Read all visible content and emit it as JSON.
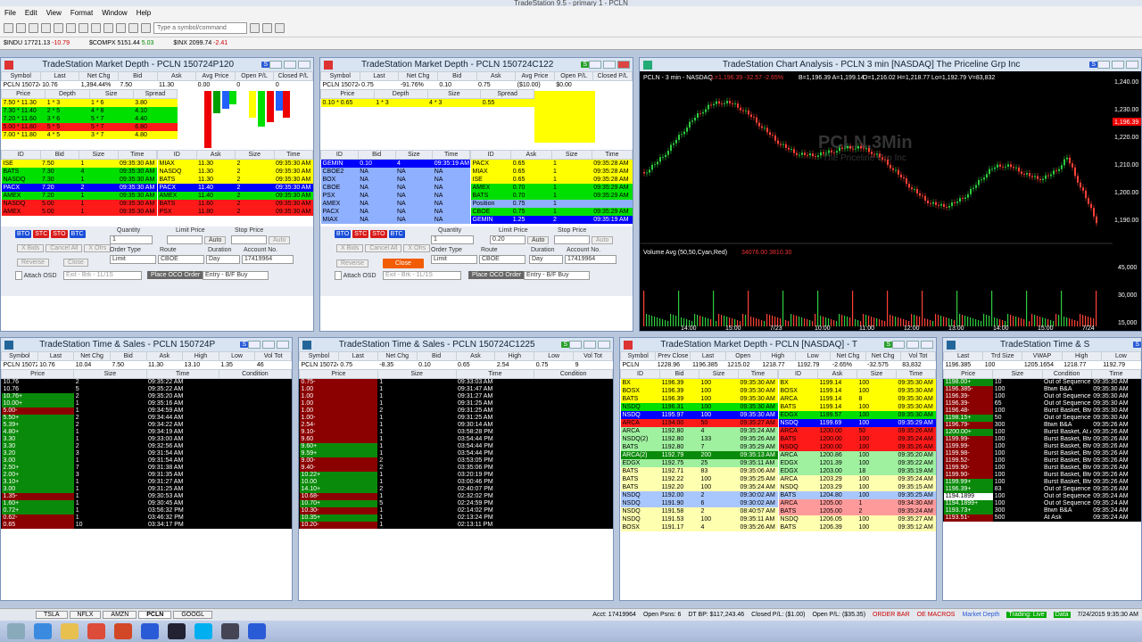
{
  "app": {
    "title": "TradeStation 9.5 - primary 1 - PCLN"
  },
  "menu": [
    "File",
    "Edit",
    "View",
    "Format",
    "Window",
    "Help"
  ],
  "toolbar": {
    "symbol_placeholder": "Type a symbol/command"
  },
  "tickers": [
    {
      "sym": "$INDU",
      "last": "17721.13",
      "chg": "-10.79"
    },
    {
      "sym": "$COMPX",
      "last": "5151.44",
      "chg": "5.03"
    },
    {
      "sym": "$INX",
      "last": "2099.74",
      "chg": "-2.41"
    }
  ],
  "md1": {
    "title": "TradeStation Market Depth - PCLN 150724P120",
    "badge": "S",
    "cols": [
      "Symbol",
      "Last",
      "Net Chg",
      "Bid",
      "Ask",
      "Avg Price",
      "Open P/L",
      "Closed P/L"
    ],
    "row": [
      "PCLN 150724P1205",
      "10.76",
      "1,394.44%",
      "7.50",
      "11.30",
      "0.00",
      "0",
      "0"
    ],
    "ladder_cols": [
      "Price",
      "Depth",
      "Size",
      "Spread"
    ],
    "ladder": [
      [
        "7.50 * 11.30",
        "1 * 3",
        "1 * 6",
        "3.80"
      ],
      [
        "7.30 * 11.40",
        "2 * 5",
        "4 * 8",
        "4.10"
      ],
      [
        "7.20 * 11.60",
        "3 * 6",
        "5 * 7",
        "4.40"
      ],
      [
        "5.00 * 11.80",
        "5 * 5",
        "5 * 7",
        "6.80"
      ],
      [
        "7.00 * 11.80",
        "4 * 5",
        "3 * 7",
        "4.80"
      ]
    ],
    "bid_cols": [
      "ID",
      "Bid",
      "Size",
      "Time"
    ],
    "bids": [
      [
        "ISE",
        "7.50",
        "1",
        "09:35:30 AM"
      ],
      [
        "BATS",
        "7.30",
        "4",
        "09:35:30 AM"
      ],
      [
        "NASDQ",
        "7.30",
        "1",
        "09:35:30 AM"
      ],
      [
        "PACX",
        "7.20",
        "2",
        "09:35:30 AM"
      ],
      [
        "AMEX",
        "7.20",
        "1",
        "09:35:30 AM"
      ],
      [
        "NASDQ",
        "5.00",
        "1",
        "09:35:30 AM"
      ],
      [
        "AMEX",
        "5.00",
        "1",
        "09:35:30 AM"
      ]
    ],
    "ask_cols": [
      "ID",
      "Ask",
      "Size",
      "Time"
    ],
    "asks": [
      [
        "MIAX",
        "11.30",
        "2",
        "09:35:30 AM"
      ],
      [
        "NASDQ",
        "11.30",
        "2",
        "09:35:30 AM"
      ],
      [
        "BATS",
        "11.30",
        "2",
        "09:35:30 AM"
      ],
      [
        "PACX",
        "11.40",
        "2",
        "09:35:30 AM"
      ],
      [
        "AMEX",
        "11.40",
        "2",
        "09:35:30 AM"
      ],
      [
        "BATS",
        "11.60",
        "2",
        "09:35:30 AM"
      ],
      [
        "PSX",
        "11.80",
        "2",
        "09:35:30 AM"
      ]
    ],
    "order": {
      "qty_label": "Quantity",
      "qty": "1",
      "limit_label": "Limit Price",
      "stop_label": "Stop Price",
      "type_label": "Order Type",
      "type": "Limit",
      "route_label": "Route",
      "route": "CBOE",
      "dur_label": "Duration",
      "dur": "Day",
      "acct_label": "Account No.",
      "acct": "17419964",
      "attach": "Attach OSD",
      "exit": "Exit - Brk - 1L/1S",
      "oco": "Place OCO Order",
      "entry": "Entry - B/F Buy",
      "reverse": "Reverse",
      "close": "Close",
      "xbids": "X Bids",
      "cancel_all": "Cancel All",
      "xoffers": "X Ofrs",
      "auto": "Auto"
    }
  },
  "md2": {
    "title": "TradeStation Market Depth - PCLN 150724C122",
    "badge": "S",
    "row": [
      "PCLN 150724C1225",
      "0.75",
      "-91.76%",
      "0.10",
      "0.75",
      "($10.00)",
      "$0.00"
    ],
    "cols": [
      "Symbol",
      "Last",
      "Net Chg",
      "Bid",
      "Ask",
      "Avg Price",
      "Open P/L",
      "Closed P/L"
    ],
    "ladder": [
      [
        "0.10 * 0.65",
        "1 * 3",
        "4 * 3",
        "0.55"
      ]
    ],
    "bids": [
      [
        "GEMIN",
        "0.10",
        "4",
        "09:35:19 AM"
      ],
      [
        "CBOE2",
        "NA",
        "NA",
        "NA"
      ],
      [
        "BOX",
        "NA",
        "NA",
        "NA"
      ],
      [
        "CBOE",
        "NA",
        "NA",
        "NA"
      ],
      [
        "PSX",
        "NA",
        "NA",
        "NA"
      ],
      [
        "AMEX",
        "NA",
        "NA",
        "NA"
      ],
      [
        "PACX",
        "NA",
        "NA",
        "NA"
      ],
      [
        "MIAX",
        "NA",
        "NA",
        "NA"
      ]
    ],
    "asks": [
      [
        "PACX",
        "0.65",
        "1",
        "09:35:28 AM"
      ],
      [
        "MIAX",
        "0.65",
        "1",
        "09:35:28 AM"
      ],
      [
        "ISE",
        "0.65",
        "1",
        "09:35:28 AM"
      ],
      [
        "AMEX",
        "0.70",
        "1",
        "09:35:29 AM"
      ],
      [
        "BATS",
        "0.70",
        "1",
        "09:35:29 AM"
      ],
      [
        "Position",
        "0.75",
        "1",
        ""
      ],
      [
        "CBOE",
        "0.75",
        "1",
        "09:35:29 AM"
      ],
      [
        "GEMIN",
        "1.25",
        "2",
        "09:35:19 AM"
      ]
    ],
    "limit_val": "0.20"
  },
  "chart": {
    "title": "TradeStation Chart Analysis - PCLN 3 min [NASDAQ] The Priceline Grp Inc",
    "badge": "S",
    "legend": "PCLN - 3 min - NASDAQ",
    "lastq": "L=1,196.39 -32.57 -2.65%",
    "bar": "B=1,196.39 A=1,199.14",
    "ohlc": "O=1,216.02 H=1,218.77 Lo=1,192.79 V=83,832",
    "watermark": "PCLN,3Min",
    "watermark_sub": "The Priceline Grp Inc",
    "vol_label": "Volume Avg (50,50,Cyan,Red)",
    "vol_vals": "34076.00  3810.30",
    "price_ticks": [
      "1,240.00",
      "1,230.00",
      "1,220.00",
      "1,210.00",
      "1,200.00",
      "1,190.00"
    ],
    "vol_ticks": [
      "45,000",
      "30,000",
      "15,000"
    ],
    "last_price": "1,196.39",
    "time_ticks": [
      "14:00",
      "15:00",
      "7/23",
      "10:00",
      "11:00",
      "12:00",
      "13:00",
      "14:00",
      "15:00",
      "7/24"
    ]
  },
  "ts1": {
    "title": "TradeStation Time & Sales - PCLN 150724P",
    "badge": "S",
    "cols": [
      "Symbol",
      "Last",
      "Net Chg",
      "Bid",
      "Ask",
      "High",
      "Low",
      "Vol Tot"
    ],
    "row": [
      "PCLN 150724P1205",
      "10.76",
      "10.04",
      "7.50",
      "11.30",
      "13.10",
      "1.35",
      "46"
    ],
    "grid_cols": [
      "Price",
      "Size",
      "Time",
      "Condition"
    ],
    "rows": [
      [
        "10.76",
        "2",
        "09:35:22 AM",
        "b"
      ],
      [
        "10.76",
        "5",
        "09:35:22 AM",
        "b"
      ],
      [
        "10.76+",
        "2",
        "09:35:20 AM",
        "g"
      ],
      [
        "10.00+",
        "1",
        "09:35:16 AM",
        "g"
      ],
      [
        "5.00-",
        "1",
        "09:34:59 AM",
        "r"
      ],
      [
        "5.50+",
        "2",
        "09:34:44 AM",
        "g"
      ],
      [
        "5.39+",
        "2",
        "09:34:22 AM",
        "g"
      ],
      [
        "4.80+",
        "1",
        "09:34:19 AM",
        "g"
      ],
      [
        "3.30",
        "1",
        "09:33:00 AM",
        "g"
      ],
      [
        "3.30",
        "2",
        "09:32:56 AM",
        "g"
      ],
      [
        "3.20",
        "3",
        "09:31:54 AM",
        "g"
      ],
      [
        "3.00",
        "1",
        "09:31:54 AM",
        "g"
      ],
      [
        "2.50+",
        "7",
        "09:31:38 AM",
        "g"
      ],
      [
        "2.00+",
        "3",
        "09:31:35 AM",
        "g"
      ],
      [
        "3.10+",
        "1",
        "09:31:27 AM",
        "g"
      ],
      [
        "3.00",
        "1",
        "09:31:25 AM",
        "g"
      ],
      [
        "1.35-",
        "1",
        "09:30:53 AM",
        "r"
      ],
      [
        "1.60+",
        "1",
        "09:30:45 AM",
        "g"
      ],
      [
        "0.72+",
        "1",
        "03:56:32 PM",
        "g"
      ],
      [
        "0.62-",
        "1",
        "03:46:32 PM",
        "r"
      ],
      [
        "0.65",
        "10",
        "03:34:17 PM",
        "r"
      ]
    ]
  },
  "ts2": {
    "title": "TradeStation Time & Sales - PCLN 150724C1225",
    "badge": "S",
    "row": [
      "PCLN 150724C1225",
      "0.75",
      "-8.35",
      "0.10",
      "0.65",
      "2.54",
      "0.75",
      "9"
    ],
    "rows": [
      [
        "0.75-",
        "1",
        "09:33:03 AM",
        "r"
      ],
      [
        "1.00",
        "1",
        "09:31:47 AM",
        "r"
      ],
      [
        "1.00",
        "1",
        "09:31:27 AM",
        "r"
      ],
      [
        "1.00",
        "1",
        "09:31:25 AM",
        "r"
      ],
      [
        "1.00",
        "2",
        "09:31:25 AM",
        "r"
      ],
      [
        "1.00-",
        "1",
        "09:31:25 AM",
        "r"
      ],
      [
        "2.54-",
        "1",
        "09:30:14 AM",
        "r"
      ],
      [
        "9.10-",
        "1",
        "03:58:28 PM",
        "r"
      ],
      [
        "9.60",
        "1",
        "03:54:44 PM",
        "r"
      ],
      [
        "9.60+",
        "1",
        "03:54:44 PM",
        "g"
      ],
      [
        "9.59+",
        "1",
        "03:54:44 PM",
        "g"
      ],
      [
        "9.00-",
        "2",
        "03:53:05 PM",
        "r"
      ],
      [
        "9.40-",
        "2",
        "03:35:06 PM",
        "r"
      ],
      [
        "10.22+",
        "1",
        "03:20:19 PM",
        "g"
      ],
      [
        "10.00",
        "1",
        "03:00:46 PM",
        "g"
      ],
      [
        "14.10+",
        "2",
        "02:40:07 PM",
        "g"
      ],
      [
        "10.68-",
        "1",
        "02:32:02 PM",
        "r"
      ],
      [
        "10.70+",
        "5",
        "02:24:59 PM",
        "g"
      ],
      [
        "10.30-",
        "1",
        "02:14:02 PM",
        "r"
      ],
      [
        "10.35+",
        "1",
        "02:13:24 PM",
        "g"
      ],
      [
        "10.20-",
        "1",
        "02:13:11 PM",
        "r"
      ]
    ]
  },
  "md3": {
    "title": "TradeStation Market Depth - PCLN [NASDAQ] - T",
    "badge": "S",
    "cols": [
      "Symbol",
      "Prev Close",
      "Last",
      "Open",
      "High",
      "Low",
      "Net Chg",
      "Net Chg",
      "Vol Tot"
    ],
    "row": [
      "PCLN",
      "1228.96",
      "1196.385",
      "1215.02",
      "1218.77",
      "1192.79",
      "-2.65%",
      "-32.575",
      "83,832"
    ],
    "bids": [
      [
        "BX",
        "1196.39",
        "100",
        "09:35:30 AM",
        "y"
      ],
      [
        "BOSX",
        "1196.39",
        "100",
        "09:35:30 AM",
        "y"
      ],
      [
        "BATS",
        "1196.39",
        "100",
        "09:35:30 AM",
        "y"
      ],
      [
        "NSDQ",
        "1196.31",
        "100",
        "09:35:30 AM",
        "g"
      ],
      [
        "NSDQ",
        "1195.97",
        "100",
        "09:35:30 AM",
        "b"
      ],
      [
        "ARCA",
        "1194.00",
        "50",
        "09:35:27 AM",
        "r"
      ],
      [
        "ARCA",
        "1192.80",
        "4",
        "09:35:24 AM",
        "lg"
      ],
      [
        "NSDQ(2)",
        "1192.80",
        "133",
        "09:35:26 AM",
        "lg"
      ],
      [
        "BATS",
        "1192.80",
        "7",
        "09:35:29 AM",
        "lg"
      ],
      [
        "ARCA(2)",
        "1192.79",
        "200",
        "09:35:13 AM",
        "dg"
      ],
      [
        "EDGX",
        "1192.75",
        "25",
        "09:35:11 AM",
        "lg"
      ],
      [
        "BATS",
        "1192.71",
        "83",
        "09:35:06 AM",
        "ly"
      ],
      [
        "BATS",
        "1192.22",
        "100",
        "09:35:25 AM",
        "ly"
      ],
      [
        "BATS",
        "1192.20",
        "100",
        "09:35:24 AM",
        "ly"
      ],
      [
        "NSDQ",
        "1192.00",
        "2",
        "09:30:02 AM",
        "lb"
      ],
      [
        "NSDQ",
        "1191.90",
        "6",
        "09:30:02 AM",
        "lb"
      ],
      [
        "NSDQ",
        "1191.58",
        "2",
        "08:40:57 AM",
        "ly"
      ],
      [
        "NSDQ",
        "1191.53",
        "100",
        "09:35:11 AM",
        "ly"
      ],
      [
        "BOSX",
        "1191.17",
        "4",
        "09:35:26 AM",
        "ly"
      ]
    ],
    "asks": [
      [
        "BX",
        "1199.14",
        "100",
        "09:35:30 AM",
        "y"
      ],
      [
        "BOSX",
        "1199.14",
        "100",
        "09:35:30 AM",
        "y"
      ],
      [
        "ARCA",
        "1199.14",
        "8",
        "09:35:30 AM",
        "y"
      ],
      [
        "BATS",
        "1199.14",
        "100",
        "09:35:30 AM",
        "y"
      ],
      [
        "EDGX",
        "1199.57",
        "100",
        "09:35:30 AM",
        "g"
      ],
      [
        "NSDQ",
        "1199.69",
        "100",
        "09:35:29 AM",
        "b"
      ],
      [
        "ARCA",
        "1200.00",
        "50",
        "09:35:26 AM",
        "r"
      ],
      [
        "BATS",
        "1200.00",
        "100",
        "09:35:24 AM",
        "r"
      ],
      [
        "NSDQ",
        "1200.00",
        "100",
        "09:35:26 AM",
        "r"
      ],
      [
        "ARCA",
        "1200.86",
        "100",
        "09:35:20 AM",
        "lg"
      ],
      [
        "EDGX",
        "1201.39",
        "100",
        "09:35:22 AM",
        "lg"
      ],
      [
        "EDGX",
        "1203.00",
        "18",
        "09:35:19 AM",
        "lg"
      ],
      [
        "ARCA",
        "1203.29",
        "100",
        "09:35:24 AM",
        "ly"
      ],
      [
        "NSDQ",
        "1203.29",
        "100",
        "09:35:15 AM",
        "ly"
      ],
      [
        "BATS",
        "1204.80",
        "100",
        "09:35:25 AM",
        "lb"
      ],
      [
        "ARCA",
        "1205.00",
        "1",
        "09:34:30 AM",
        "lr"
      ],
      [
        "BATS",
        "1205.00",
        "2",
        "09:35:24 AM",
        "lr"
      ],
      [
        "NSDQ",
        "1206.05",
        "100",
        "09:35:27 AM",
        "ly"
      ],
      [
        "BATS",
        "1206.39",
        "100",
        "09:35:12 AM",
        "ly"
      ]
    ]
  },
  "ts4": {
    "title": "TradeStation Time & S",
    "badge": "S",
    "cols": [
      "Last",
      "Trd Size",
      "VWAP",
      "High",
      "Low"
    ],
    "row": [
      "1196.385",
      "100",
      "1205.1654",
      "1218.77",
      "1192.79"
    ],
    "grid_cols": [
      "Price",
      "Size",
      "Condition",
      "Time"
    ],
    "rows": [
      [
        "1198.00+",
        "10",
        "Out of Sequence, Bl",
        "09:35:30 AM",
        "g"
      ],
      [
        "1196.385-",
        "100",
        "Btwn B&A",
        "09:35:30 AM",
        "r"
      ],
      [
        "1196.39-",
        "100",
        "Out of Sequence, Bl",
        "09:35:30 AM",
        "r"
      ],
      [
        "1196.39-",
        "65",
        "Out of Sequence, Bl",
        "09:35:30 AM",
        "r"
      ],
      [
        "1196.48-",
        "100",
        "Burst Basket, Btwn",
        "09:35:30 AM",
        "r"
      ],
      [
        "1198.15+",
        "50",
        "Out of Sequence, Bl",
        "09:35:30 AM",
        "g"
      ],
      [
        "1196.79-",
        "300",
        "Btwn B&A",
        "09:35:26 AM",
        "r"
      ],
      [
        "1200.00+",
        "100",
        "Burst Basket, At Ask",
        "09:35:26 AM",
        "g"
      ],
      [
        "1199.99-",
        "100",
        "Burst Basket, Btwn",
        "09:35:26 AM",
        "r"
      ],
      [
        "1199.99-",
        "100",
        "Burst Basket, Btwn",
        "09:35:26 AM",
        "r"
      ],
      [
        "1199.98-",
        "100",
        "Burst Basket, Btwn",
        "09:35:26 AM",
        "r"
      ],
      [
        "1199.52-",
        "100",
        "Burst Basket, Btwn",
        "09:35:26 AM",
        "r"
      ],
      [
        "1199.90-",
        "100",
        "Burst Basket, Btwn",
        "09:35:26 AM",
        "r"
      ],
      [
        "1199.90-",
        "100",
        "Burst Basket, Btwn",
        "09:35:26 AM",
        "r"
      ],
      [
        "1199.99+",
        "100",
        "Burst Basket, Btwn",
        "09:35:26 AM",
        "g"
      ],
      [
        "1196.39+",
        "83",
        "Out of Sequence, Bl",
        "09:35:26 AM",
        "g"
      ],
      [
        "1194.1899",
        "100",
        "Out of Sequence, Bl",
        "09:35:24 AM",
        "w"
      ],
      [
        "1194.1899+",
        "100",
        "Out of Sequence, Bl",
        "09:35:24 AM",
        "g"
      ],
      [
        "1193.73+",
        "300",
        "Btwn B&A",
        "09:35:24 AM",
        "g"
      ],
      [
        "1193.51-",
        "500",
        "At Ask",
        "09:35:24 AM",
        "r"
      ]
    ]
  },
  "tabs": [
    "TSLA",
    "NFLX",
    "AMZN",
    "PCLN",
    "GOOGL"
  ],
  "status": {
    "acct": "Acct: 17419964",
    "open": "Open Psns: 6",
    "dtbp": "DT BP: $117,243.46",
    "closed": "Closed P/L: ($1.00)",
    "openpl": "Open P/L: ($35.35)",
    "orderbar": "ORDER BAR",
    "oe": "OE MACROS",
    "md": "Market Depth",
    "trading": "Trading: Live",
    "data": "Data",
    "time": "7/24/2015 9:35:30 AM"
  },
  "colors": {
    "accent": "#2a5bd7",
    "up": "#00e000",
    "down": "#ff1a1a",
    "highlight": "#ffff00"
  }
}
